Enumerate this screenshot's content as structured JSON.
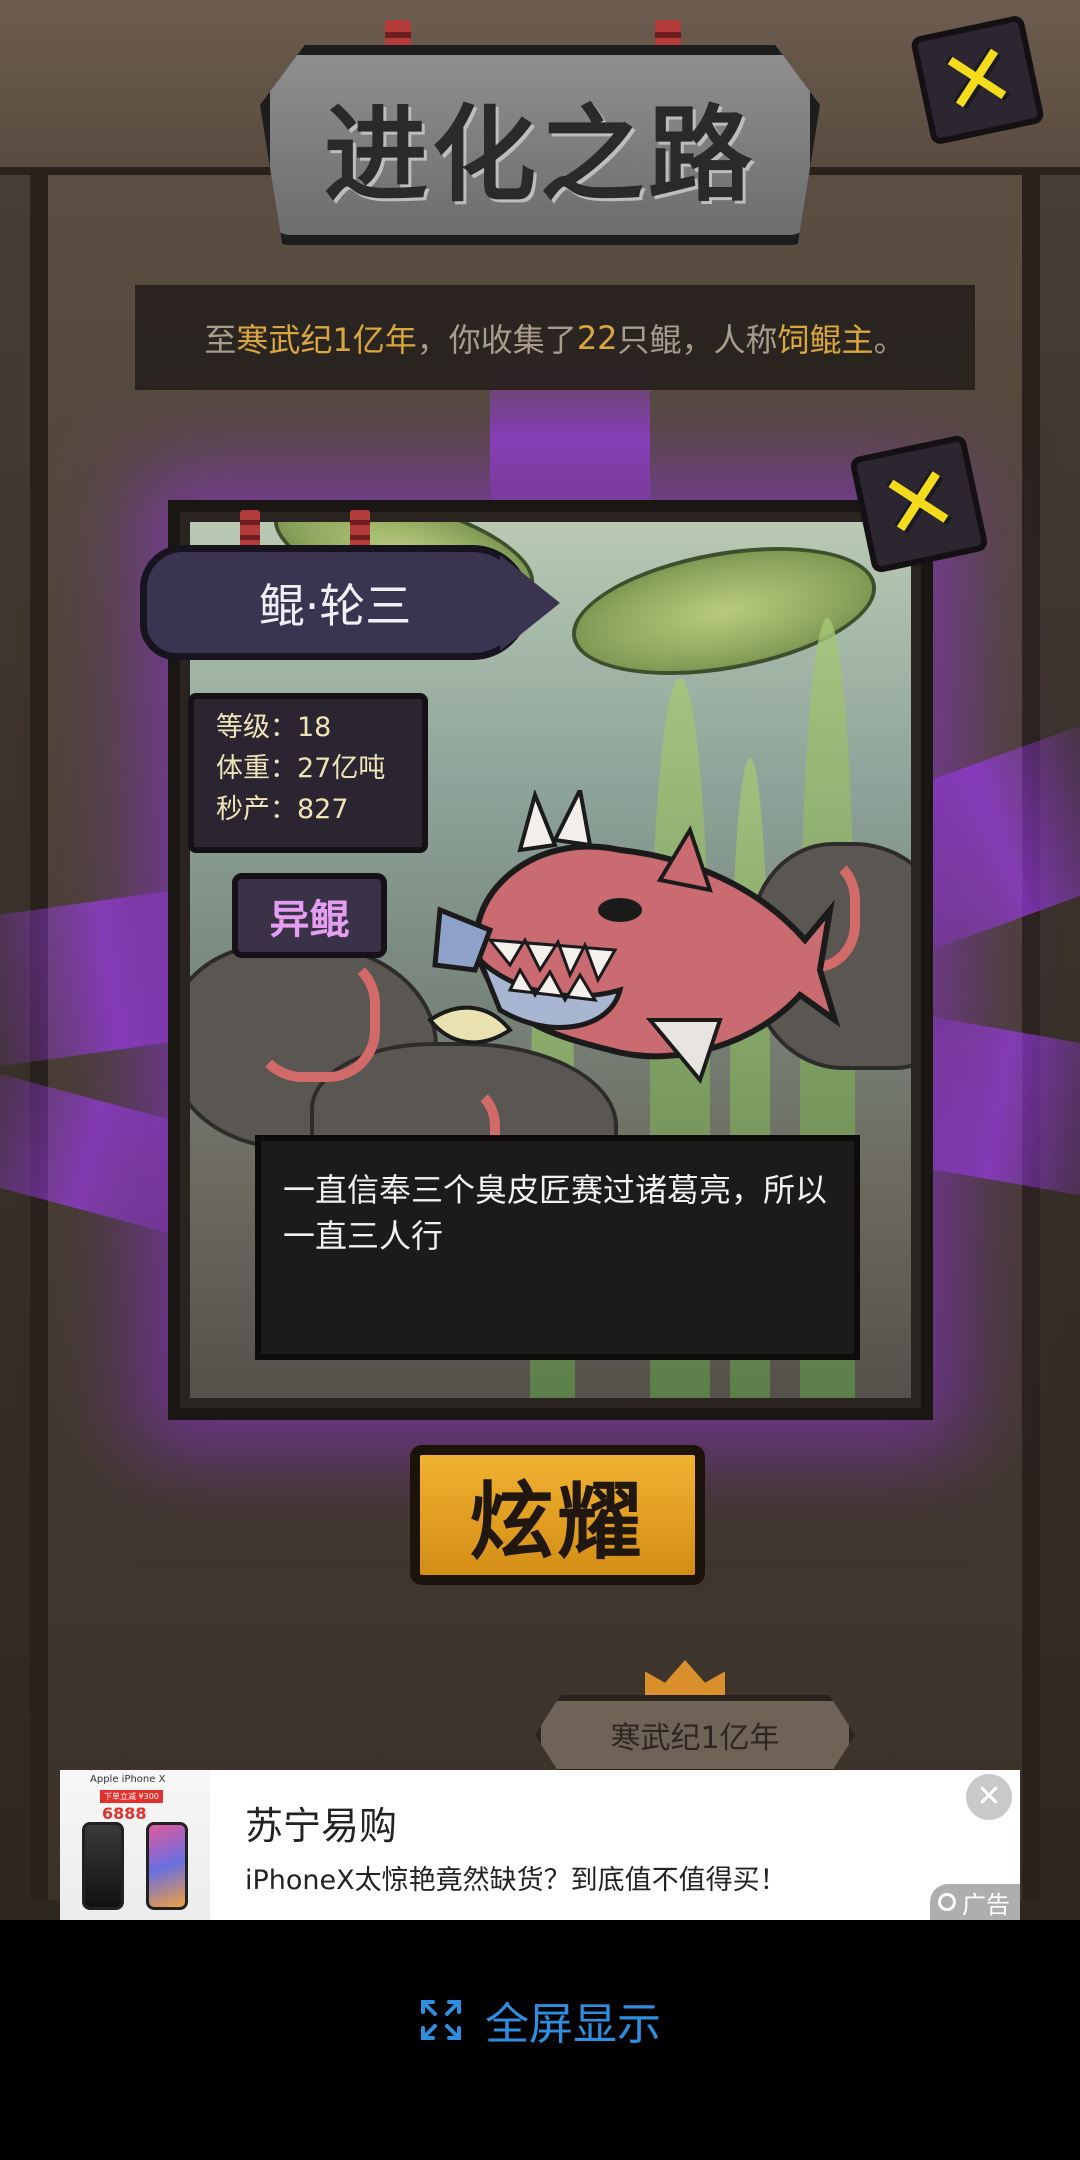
{
  "title": "进化之路",
  "summary": {
    "prefix": "至",
    "era": "寒武纪1亿年",
    "mid": "，你收集了",
    "count": "22",
    "unit": "只鲲，人称",
    "honor": "饲鲲主",
    "end": "。"
  },
  "card": {
    "name": "鲲·轮三",
    "stats": [
      {
        "label": "等级：18"
      },
      {
        "label": "体重：27亿吨"
      },
      {
        "label": "秒产：827"
      }
    ],
    "type_tag": "异鲲",
    "description": "一直信奉三个臭皮匠赛过诸葛亮，所以一直三人行"
  },
  "buttons": {
    "show_off": "炫耀",
    "close_symbol": "✕"
  },
  "era_badge": "寒武纪1亿年",
  "ad": {
    "brand": "苏宁易购",
    "description": "iPhoneX太惊艳竟然缺货？到底值不值得买！",
    "label": "广告",
    "close": "✕",
    "thumb_model": "Apple iPhone X",
    "thumb_promo": "下单立减 ¥300",
    "thumb_price": "6888"
  },
  "fullscreen": {
    "label": "全屏显示"
  },
  "colors": {
    "highlight": "#d9a640",
    "purple_glow": "#a040f0",
    "close_yellow": "#f4dc1c",
    "button_orange": "#e8a128",
    "fullscreen_blue": "#2e8ee0"
  },
  "icons": {
    "close": "close-x-icon",
    "fullscreen": "expand-icon",
    "ad": "ad-ring-icon"
  }
}
